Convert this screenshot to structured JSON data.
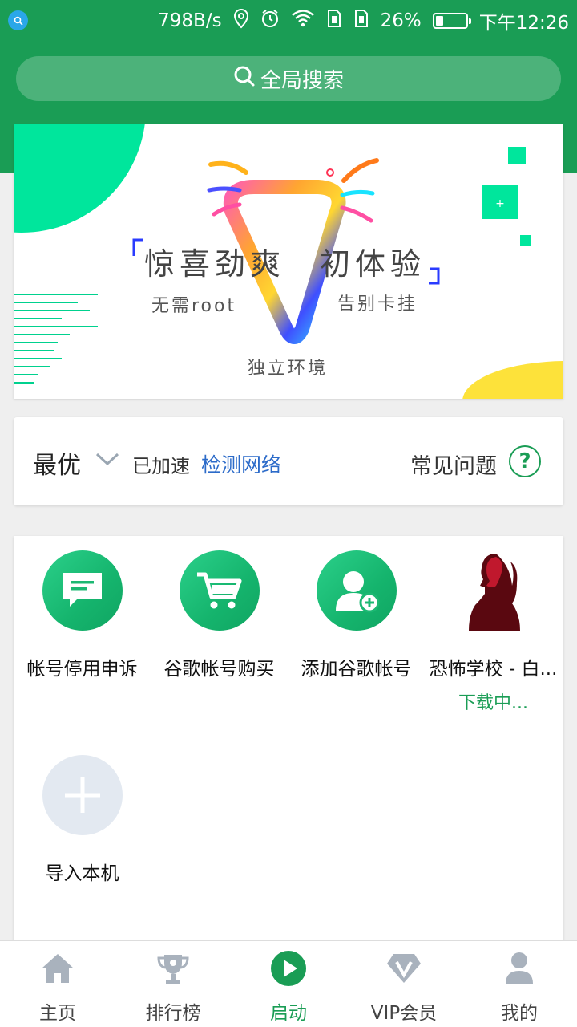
{
  "status_bar": {
    "speed": "798B/s",
    "battery": "26%",
    "battery_level": 0.26,
    "time": "下午12:26"
  },
  "search": {
    "label": "全局搜索"
  },
  "banner": {
    "headline_1": "惊喜劲爽",
    "headline_2": "初体验",
    "tag_left": "无需root",
    "tag_right": "告别卡挂",
    "tag_bottom": "独立环境"
  },
  "network": {
    "mode": "最优",
    "status": "已加速",
    "detect_link": "检测网络",
    "faq": "常见问题"
  },
  "apps": [
    {
      "label": "帐号停用申诉",
      "icon": "chat-icon"
    },
    {
      "label": "谷歌帐号购买",
      "icon": "cart-icon"
    },
    {
      "label": "添加谷歌帐号",
      "icon": "add-user-icon"
    },
    {
      "label": "恐怖学校 - 白...",
      "icon": "game-girl-icon",
      "status": "下载中..."
    },
    {
      "label": "导入本机",
      "icon": "plus-icon"
    }
  ],
  "nav": [
    {
      "label": "主页",
      "icon": "home-icon"
    },
    {
      "label": "排行榜",
      "icon": "trophy-icon"
    },
    {
      "label": "启动",
      "icon": "play-icon",
      "active": true
    },
    {
      "label": "VIP会员",
      "icon": "vip-diamond-icon"
    },
    {
      "label": "我的",
      "icon": "person-icon"
    }
  ],
  "colors": {
    "brand_green": "#1a9d55",
    "link_blue": "#2c6bc9",
    "banner_yellow": "#fde23a",
    "banner_mint": "#00e69c"
  }
}
